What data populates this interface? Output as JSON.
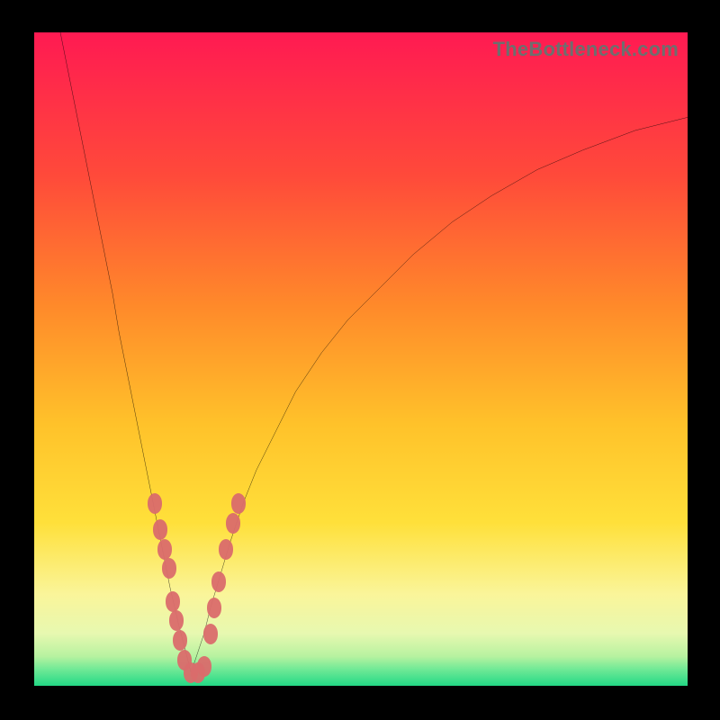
{
  "watermark": "TheBottleneck.com",
  "colors": {
    "frame": "#000000",
    "grad_top": "#ff1a52",
    "grad_mid1": "#ff5a2e",
    "grad_mid2": "#ffb020",
    "grad_mid3": "#ffe13a",
    "grad_mid4": "#faf59a",
    "grad_bottom1": "#d7f7a0",
    "grad_bottom2": "#2fe08a",
    "curve": "#000000",
    "dot": "#da6c6c"
  },
  "chart_data": {
    "type": "line",
    "title": "",
    "xlabel": "",
    "ylabel": "",
    "xlim": [
      0,
      100
    ],
    "ylim": [
      0,
      100
    ],
    "series": [
      {
        "name": "left-branch",
        "x": [
          4,
          6,
          8,
          10,
          12,
          13,
          14,
          15,
          16,
          17,
          18,
          19,
          20,
          20.8,
          21.5,
          22.2,
          23,
          23.5,
          24
        ],
        "values": [
          100,
          90,
          80,
          70,
          60,
          54,
          49,
          44,
          39,
          34,
          29,
          24,
          19,
          15,
          12,
          9,
          6,
          4,
          2
        ]
      },
      {
        "name": "right-branch",
        "x": [
          24,
          25,
          26,
          27,
          28.5,
          30,
          32,
          34,
          37,
          40,
          44,
          48,
          53,
          58,
          64,
          70,
          77,
          84,
          92,
          100
        ],
        "values": [
          2,
          5,
          8,
          12,
          17,
          22,
          28,
          33,
          39,
          45,
          51,
          56,
          61,
          66,
          71,
          75,
          79,
          82,
          85,
          87
        ]
      }
    ],
    "markers": [
      {
        "x": 18.5,
        "y": 28
      },
      {
        "x": 19.3,
        "y": 24
      },
      {
        "x": 20.0,
        "y": 21
      },
      {
        "x": 20.6,
        "y": 18
      },
      {
        "x": 21.2,
        "y": 13
      },
      {
        "x": 21.7,
        "y": 10
      },
      {
        "x": 22.3,
        "y": 7
      },
      {
        "x": 23.0,
        "y": 4
      },
      {
        "x": 24.0,
        "y": 2
      },
      {
        "x": 25.0,
        "y": 2
      },
      {
        "x": 26.0,
        "y": 3
      },
      {
        "x": 27.0,
        "y": 8
      },
      {
        "x": 27.6,
        "y": 12
      },
      {
        "x": 28.3,
        "y": 16
      },
      {
        "x": 29.4,
        "y": 21
      },
      {
        "x": 30.4,
        "y": 25
      },
      {
        "x": 31.3,
        "y": 28
      }
    ],
    "legend": false,
    "grid": false
  }
}
